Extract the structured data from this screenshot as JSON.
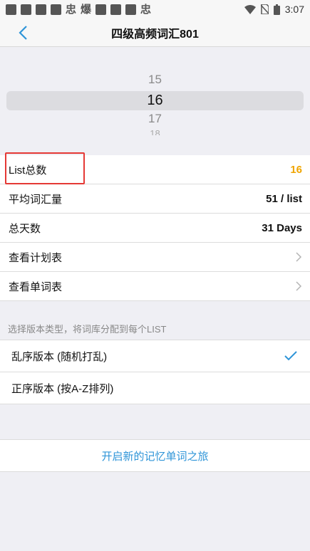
{
  "status_bar": {
    "time": "3:07",
    "left_glyphs": [
      "忠",
      "爆",
      "忠"
    ]
  },
  "nav": {
    "title": "四级高频词汇801",
    "back_icon": "chevron-left-icon"
  },
  "picker": {
    "items": [
      "15",
      "16",
      "17",
      "18"
    ],
    "selected": "16"
  },
  "settings": {
    "rows": [
      {
        "label": "List总数",
        "value": "16"
      },
      {
        "label": "平均词汇量",
        "value": "51 / list"
      },
      {
        "label": "总天数",
        "value": "31 Days"
      },
      {
        "label": "查看计划表"
      },
      {
        "label": "查看单词表"
      }
    ]
  },
  "version": {
    "header": "选择版本类型，将词库分配到每个LIST",
    "options": [
      {
        "label": "乱序版本 (随机打乱)",
        "selected": true
      },
      {
        "label": "正序版本 (按A-Z排列)",
        "selected": false
      }
    ]
  },
  "action": {
    "start_label": "开启新的记忆单词之旅"
  },
  "colors": {
    "accent_orange": "#f0a500",
    "accent_blue": "#2f95d8",
    "highlight_red": "#e53935"
  }
}
